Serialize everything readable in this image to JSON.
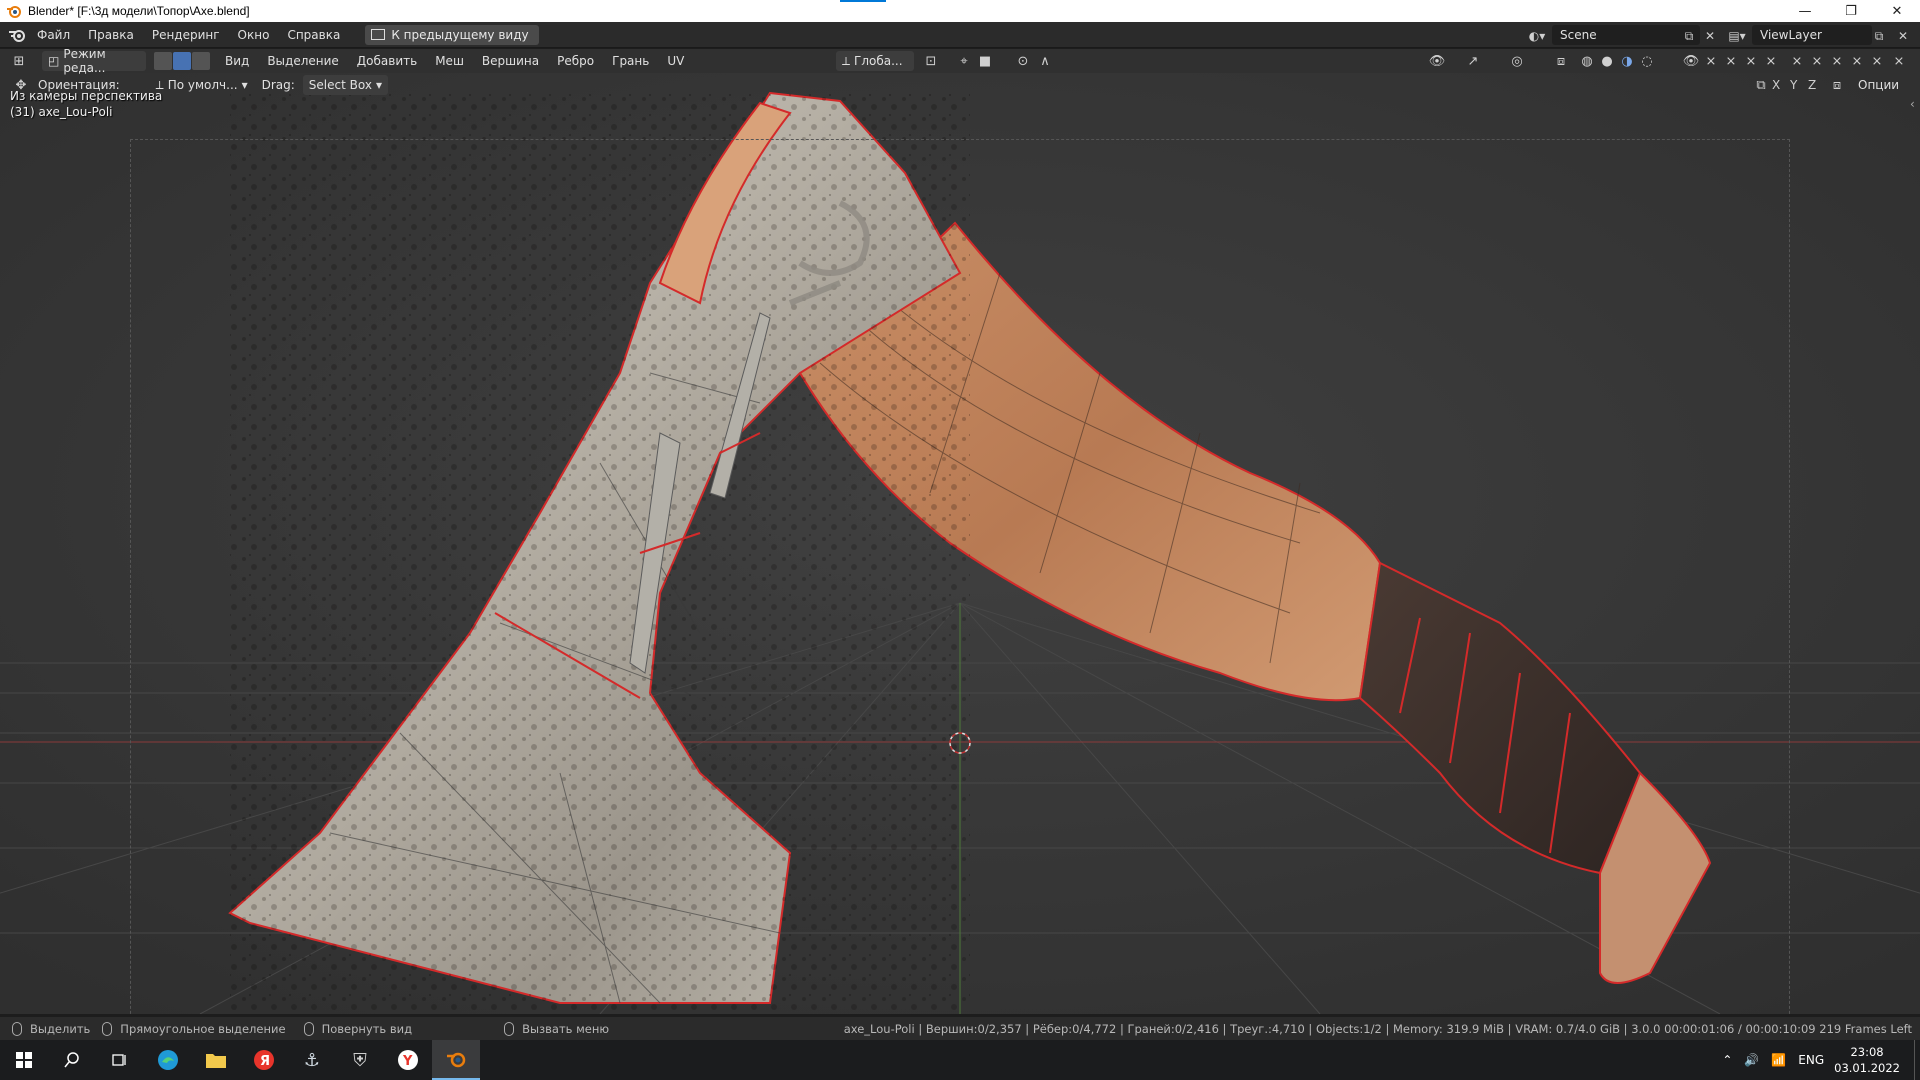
{
  "window": {
    "title": "Blender* [F:\\3д модели\\Топор\\Axe.blend]",
    "minimize": "—",
    "restore": "❐",
    "close": "✕"
  },
  "topbar": {
    "menus": [
      "Файл",
      "Правка",
      "Рендеринг",
      "Окно",
      "Справка"
    ],
    "back_button": "К предыдущему виду",
    "scene": "Scene",
    "view_layer": "ViewLayer"
  },
  "header": {
    "mode": "Режим реда...",
    "menus": [
      "Вид",
      "Выделение",
      "Добавить",
      "Меш",
      "Вершина",
      "Ребро",
      "Грань",
      "UV"
    ],
    "orientation_dropdown": "Глоба...",
    "options": "Опции"
  },
  "toolrow": {
    "orientation_label": "Ориентация:",
    "orientation_value": "По умолч...",
    "drag_label": "Drag:",
    "drag_value": "Select Box",
    "axes": [
      "X",
      "Y",
      "Z"
    ]
  },
  "viewport": {
    "view_name": "Из камеры перспектива",
    "object_name": "(31) axe_Lou-Poli"
  },
  "statusbar": {
    "select": "Выделить",
    "box_select": "Прямоугольное выделение",
    "rotate_view": "Повернуть вид",
    "call_menu": "Вызвать меню",
    "stats": "axe_Lou-Poli | Вершин:0/2,357 | Рёбер:0/4,772 | Граней:0/2,416 | Треуг.:4,710 | Objects:1/2 | Memory: 319.9 MiB | VRAM: 0.7/4.0 GiB | 3.0.0   00:00:01:06 / 00:00:10:09  219 Frames Left"
  },
  "taskbar": {
    "lang": "ENG",
    "time": "23:08",
    "date": "03.01.2022"
  },
  "colors": {
    "accent": "#4772b3",
    "edge_seam": "#d42a2a",
    "viewport_bg": "#393939"
  }
}
